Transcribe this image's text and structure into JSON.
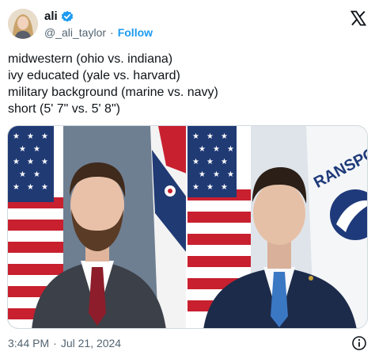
{
  "tweet": {
    "display_name": "ali",
    "handle": "@_ali_taylor",
    "separator": "·",
    "follow_label": "Follow",
    "lines": [
      "midwestern (ohio vs. indiana)",
      "ivy educated (yale vs. harvard)",
      "military background (marine vs. navy)",
      "short (5' 7\" vs. 5' 8\")"
    ],
    "time": "3:44 PM",
    "date": "Jul 21, 2024"
  },
  "icons": {
    "verified": "verified-badge-icon",
    "brand": "x-logo-icon",
    "info": "info-icon"
  },
  "colors": {
    "accent": "#1d9bf0",
    "text": "#0f1419",
    "muted": "#536471",
    "border": "#cfd9de"
  },
  "media": {
    "left_photo_backdrop_text": "",
    "right_photo_backdrop_text": "RANSPO"
  }
}
